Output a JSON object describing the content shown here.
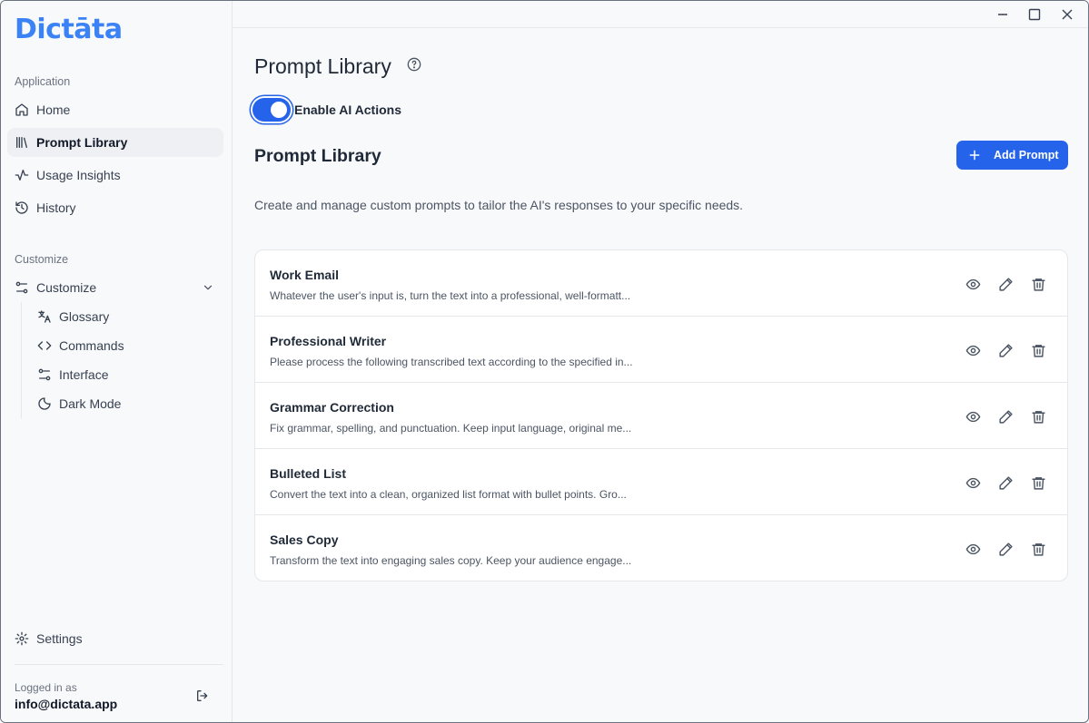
{
  "app": {
    "logo": "Dictāta"
  },
  "sidebar": {
    "application_label": "Application",
    "items": [
      {
        "label": "Home",
        "icon": "home-icon"
      },
      {
        "label": "Prompt Library",
        "icon": "library-icon",
        "active": true
      },
      {
        "label": "Usage Insights",
        "icon": "activity-icon"
      },
      {
        "label": "History",
        "icon": "history-icon"
      }
    ],
    "customize_label": "Customize",
    "customize_item": {
      "label": "Customize",
      "icon": "sliders-icon",
      "expanded": true
    },
    "sub_items": [
      {
        "label": "Glossary",
        "icon": "translate-icon"
      },
      {
        "label": "Commands",
        "icon": "code-icon"
      },
      {
        "label": "Interface",
        "icon": "sliders-icon"
      },
      {
        "label": "Dark Mode",
        "icon": "moon-icon"
      }
    ],
    "settings": {
      "label": "Settings",
      "icon": "gear-icon"
    },
    "account": {
      "logged_in_label": "Logged in as",
      "email": "info@dictata.app"
    }
  },
  "main": {
    "page_title": "Prompt Library",
    "toggle": {
      "label": "Enable AI Actions",
      "on": true
    },
    "section_title": "Prompt Library",
    "add_button": "Add Prompt",
    "description": "Create and manage custom prompts to tailor the AI's responses to your specific needs.",
    "prompts": [
      {
        "title": "Work Email",
        "preview": "Whatever the user's input is, turn the text into a professional, well-formatt..."
      },
      {
        "title": "Professional Writer",
        "preview": "Please process the following transcribed text according to the specified in..."
      },
      {
        "title": "Grammar Correction",
        "preview": "Fix grammar, spelling, and punctuation. Keep input language, original me..."
      },
      {
        "title": "Bulleted List",
        "preview": "Convert the text into a clean, organized list format with bullet points. Gro..."
      },
      {
        "title": "Sales Copy",
        "preview": "Transform the text into engaging sales copy. Keep your audience engage..."
      }
    ]
  },
  "colors": {
    "accent": "#2563eb",
    "logo": "#3b82f6",
    "text": "#1f2937",
    "muted": "#6b7280"
  }
}
